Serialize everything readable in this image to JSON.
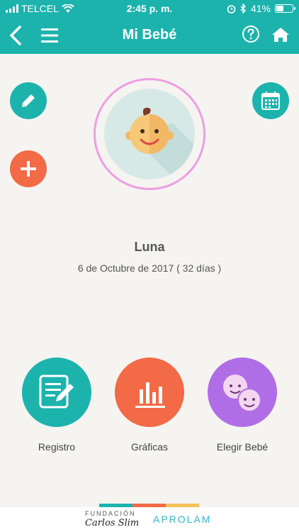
{
  "status_bar": {
    "carrier": "TELCEL",
    "time": "2:45 p. m.",
    "battery": "41%",
    "battery_level": 0.41
  },
  "header": {
    "title": "Mi Bebé",
    "back_icon": "back-chevron-icon",
    "menu_icon": "hamburger-menu-icon",
    "help_icon": "help-icon",
    "home_icon": "home-icon"
  },
  "actions": {
    "edit_icon": "pencil-icon",
    "add_icon": "plus-icon",
    "calendar_icon": "calendar-icon"
  },
  "baby": {
    "name": "Luna",
    "birth_info": "6 de Octubre de 2017  ( 32 días )"
  },
  "main_actions": [
    {
      "label": "Registro",
      "icon": "document-edit-icon",
      "color": "#1cb3ad"
    },
    {
      "label": "Gráficas",
      "icon": "bar-chart-icon",
      "color": "#f26a46"
    },
    {
      "label": "Elegir Bebé",
      "icon": "babies-icon",
      "color": "#b06ee6"
    }
  ],
  "footer": {
    "fundacion": "FUNDACIÓN",
    "carlos_slim": "Carlos Slim",
    "aprolam": "APROLAM"
  },
  "colors": {
    "primary": "#1cb3ad",
    "accent_orange": "#f26a46",
    "accent_purple": "#b06ee6",
    "avatar_ring": "#ee9ee2",
    "background": "#f5f4f1"
  }
}
